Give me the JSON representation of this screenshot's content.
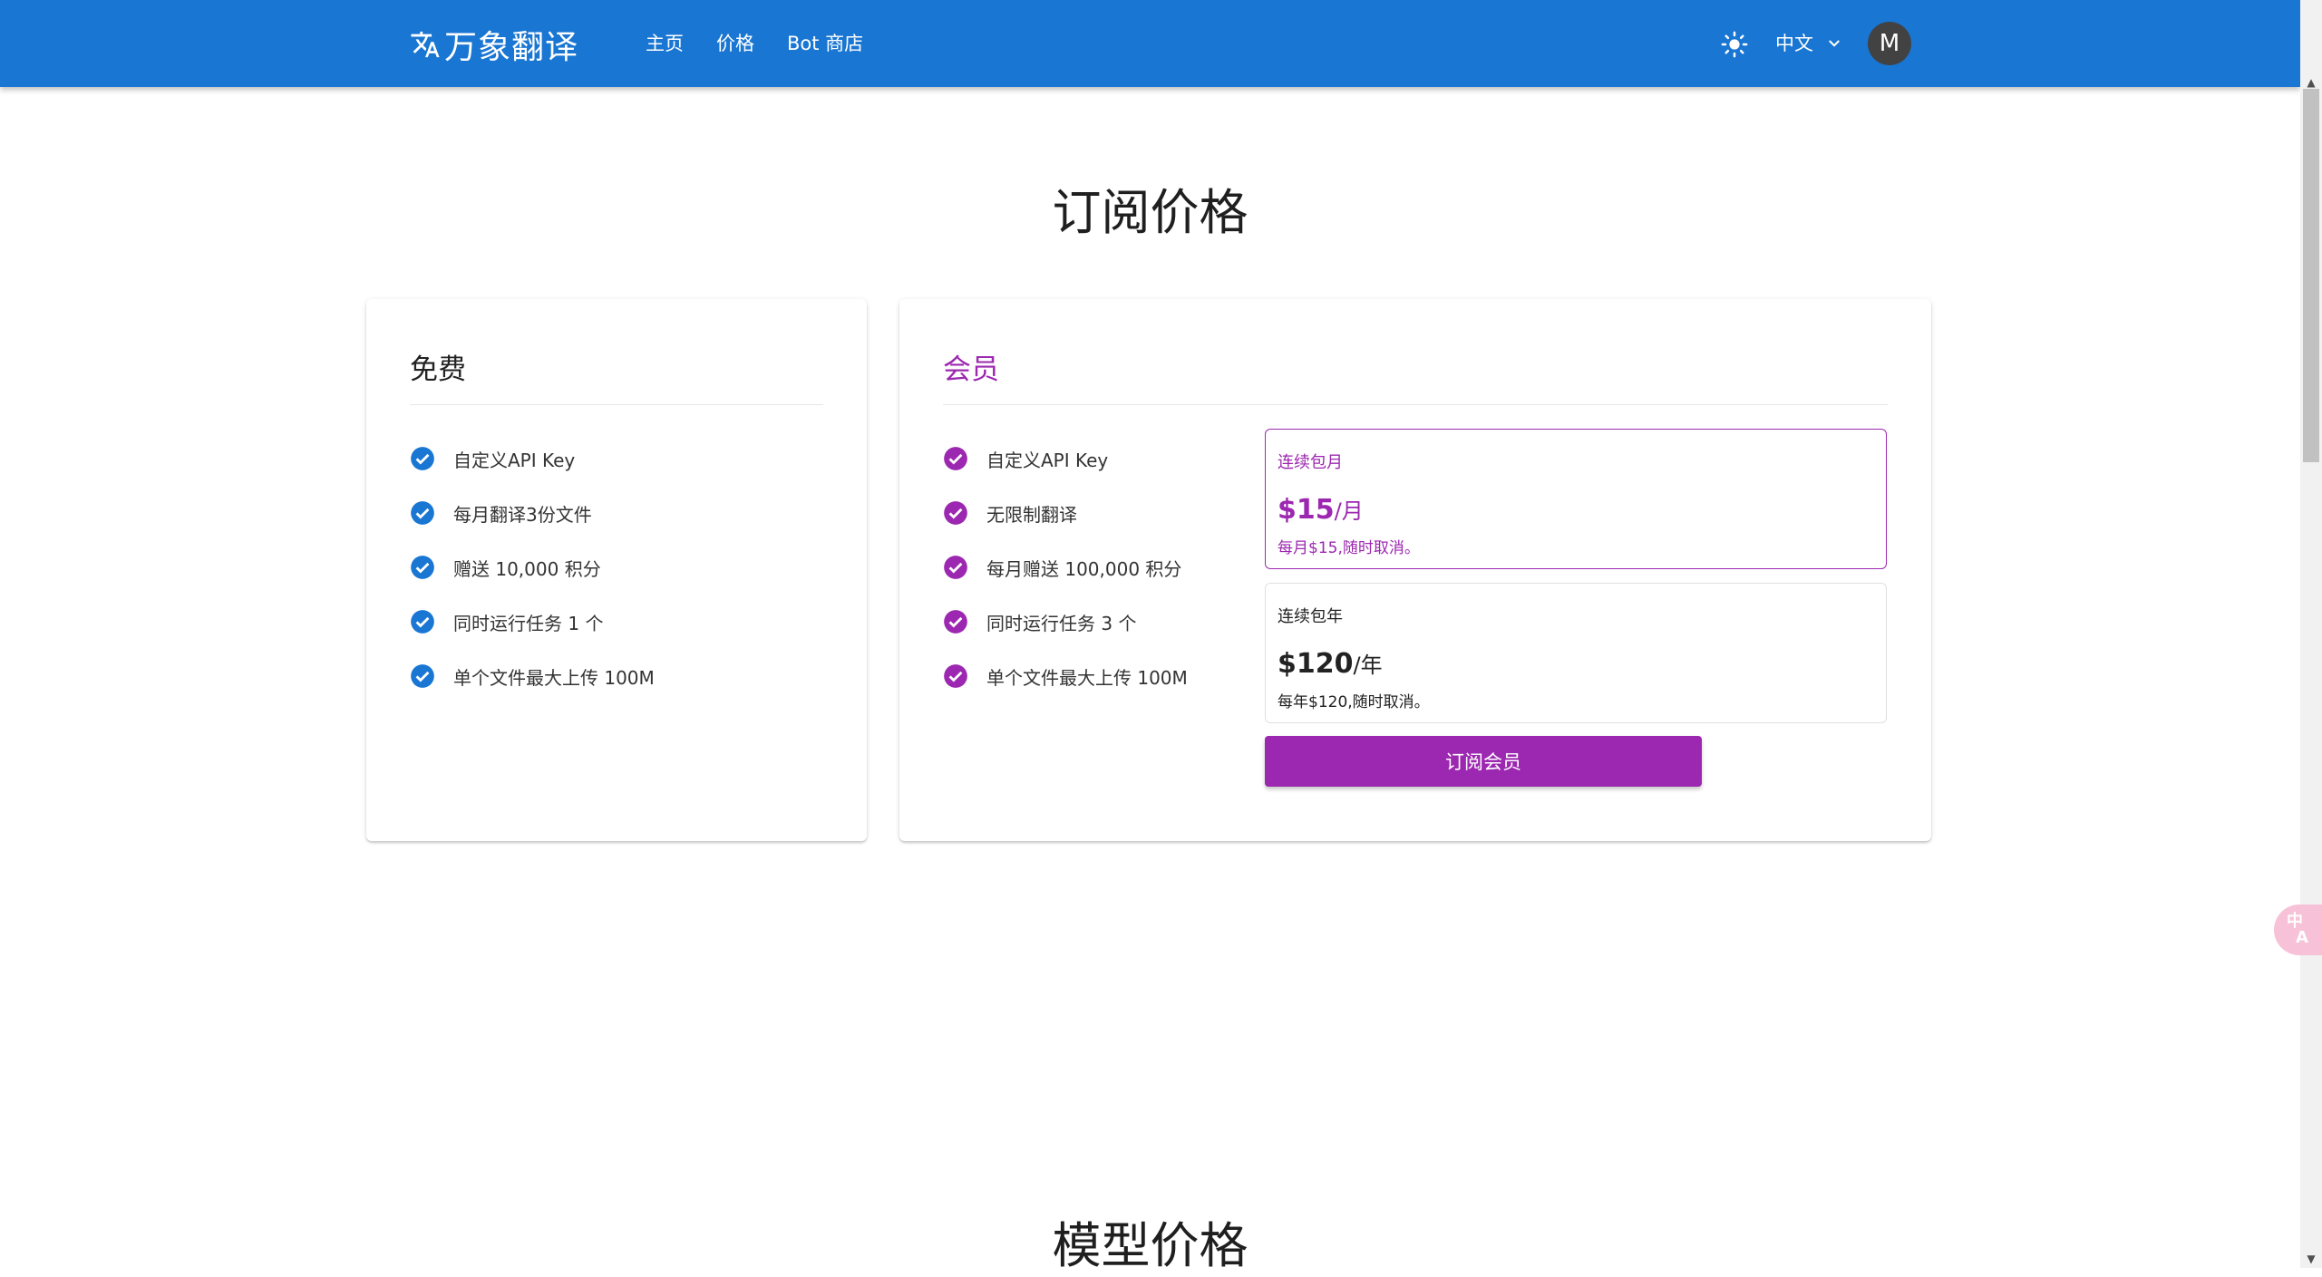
{
  "header": {
    "brand": "万象翻译",
    "nav": [
      "主页",
      "价格",
      "Bot 商店"
    ],
    "language": "中文",
    "avatar_initial": "M",
    "icons": {
      "logo": "translate-icon",
      "theme": "sun-icon",
      "language_dropdown": "chevron-down-icon"
    },
    "color": "#1976d2"
  },
  "page": {
    "subscription_title": "订阅价格",
    "model_title": "模型价格"
  },
  "free_plan": {
    "title": "免费",
    "accent_color": "#1976d2",
    "features": [
      "自定义API Key",
      "每月翻译3份文件",
      "赠送 10,000 积分",
      "同时运行任务 1 个",
      "单个文件最大上传 100M"
    ]
  },
  "member_plan": {
    "title": "会员",
    "accent_color": "#9c27b0",
    "features": [
      "自定义API Key",
      "无限制翻译",
      "每月赠送 100,000 积分",
      "同时运行任务 3 个",
      "单个文件最大上传 100M"
    ],
    "options": [
      {
        "name": "连续包月",
        "price": "$15",
        "unit": "/月",
        "desc": "每月$15,随时取消。",
        "selected": true
      },
      {
        "name": "连续包年",
        "price": "$120",
        "unit": "/年",
        "desc": "每年$120,随时取消。",
        "selected": false
      }
    ],
    "subscribe_button": "订阅会员"
  },
  "floating_button": {
    "label_top": "中",
    "label_bottom": "A",
    "color": "#f7c2d8"
  }
}
